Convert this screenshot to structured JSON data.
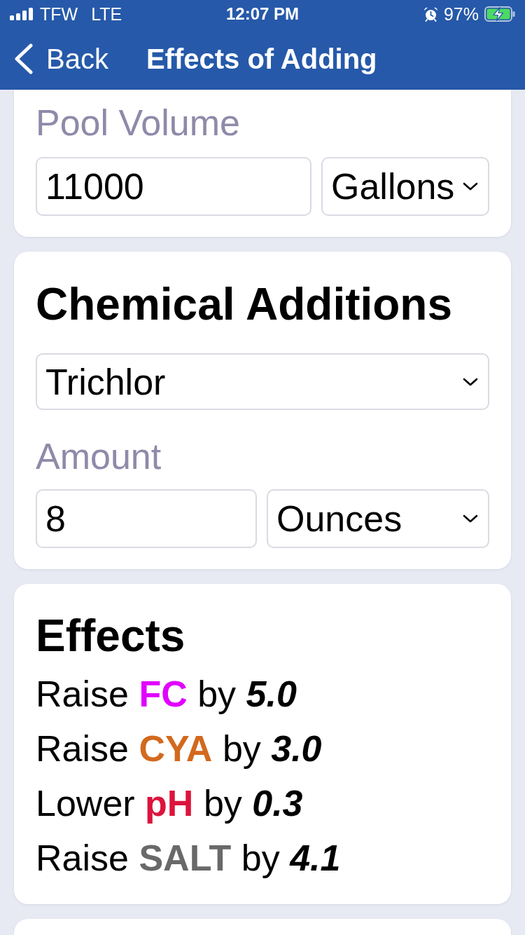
{
  "status_bar": {
    "carrier": "TFW",
    "network": "LTE",
    "time": "12:07 PM",
    "battery_percent": "97%",
    "battery_charging": true
  },
  "nav_bar": {
    "back_label": "Back",
    "title": "Effects of Adding"
  },
  "pool_volume": {
    "label": "Pool Volume",
    "value": "11000",
    "unit": "Gallons"
  },
  "chemical_additions": {
    "title": "Chemical Additions",
    "chemical": "Trichlor",
    "amount_label": "Amount",
    "amount_value": "8",
    "amount_unit": "Ounces"
  },
  "effects": {
    "title": "Effects",
    "items": [
      {
        "verb": "Raise",
        "parameter": "FC",
        "color": "#e100ff",
        "preposition": "by",
        "amount": "5.0"
      },
      {
        "verb": "Raise",
        "parameter": "CYA",
        "color": "#d2691e",
        "preposition": "by",
        "amount": "3.0"
      },
      {
        "verb": "Lower",
        "parameter": "pH",
        "color": "#dc143c",
        "preposition": "by",
        "amount": "0.3"
      },
      {
        "verb": "Raise",
        "parameter": "SALT",
        "color": "#696969",
        "preposition": "by",
        "amount": "4.1"
      }
    ]
  }
}
